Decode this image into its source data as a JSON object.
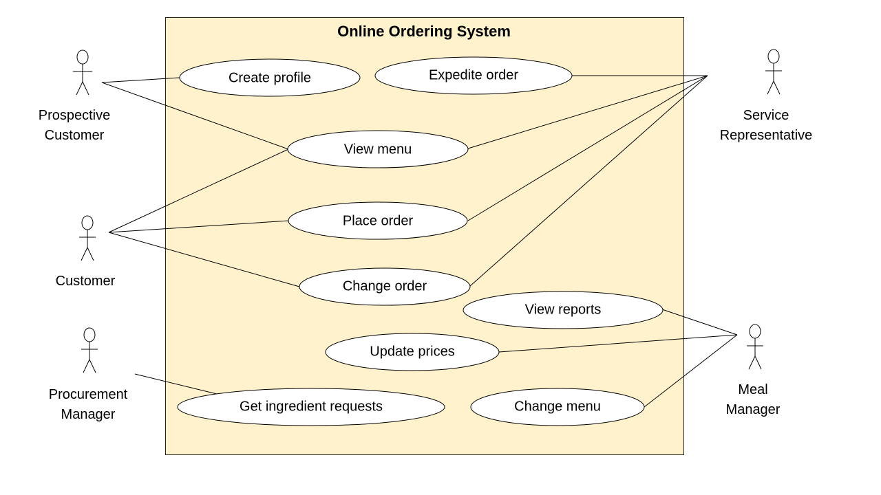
{
  "system": {
    "title": "Online Ordering System",
    "fill_color": "#fff2cc"
  },
  "actors": [
    {
      "id": "prospective-customer",
      "lines": [
        "Prospective",
        "Customer"
      ]
    },
    {
      "id": "customer",
      "lines": [
        "Customer"
      ]
    },
    {
      "id": "procurement-manager",
      "lines": [
        "Procurement",
        "Manager"
      ]
    },
    {
      "id": "service-representative",
      "lines": [
        "Service",
        "Representative"
      ]
    },
    {
      "id": "meal-manager",
      "lines": [
        "Meal",
        "Manager"
      ]
    }
  ],
  "use_cases": [
    {
      "id": "create-profile",
      "label": "Create profile"
    },
    {
      "id": "expedite-order",
      "label": "Expedite order"
    },
    {
      "id": "view-menu",
      "label": "View menu"
    },
    {
      "id": "place-order",
      "label": "Place order"
    },
    {
      "id": "change-order",
      "label": "Change order"
    },
    {
      "id": "view-reports",
      "label": "View reports"
    },
    {
      "id": "update-prices",
      "label": "Update prices"
    },
    {
      "id": "get-ingredient-requests",
      "label": "Get ingredient requests"
    },
    {
      "id": "change-menu",
      "label": "Change menu"
    }
  ],
  "associations": [
    {
      "actor": "prospective-customer",
      "use_case": "create-profile"
    },
    {
      "actor": "prospective-customer",
      "use_case": "view-menu"
    },
    {
      "actor": "customer",
      "use_case": "view-menu"
    },
    {
      "actor": "customer",
      "use_case": "place-order"
    },
    {
      "actor": "customer",
      "use_case": "change-order"
    },
    {
      "actor": "service-representative",
      "use_case": "expedite-order"
    },
    {
      "actor": "service-representative",
      "use_case": "view-menu"
    },
    {
      "actor": "service-representative",
      "use_case": "place-order"
    },
    {
      "actor": "service-representative",
      "use_case": "change-order"
    },
    {
      "actor": "meal-manager",
      "use_case": "view-reports"
    },
    {
      "actor": "meal-manager",
      "use_case": "update-prices"
    },
    {
      "actor": "meal-manager",
      "use_case": "change-menu"
    },
    {
      "actor": "procurement-manager",
      "use_case": "get-ingredient-requests"
    }
  ]
}
